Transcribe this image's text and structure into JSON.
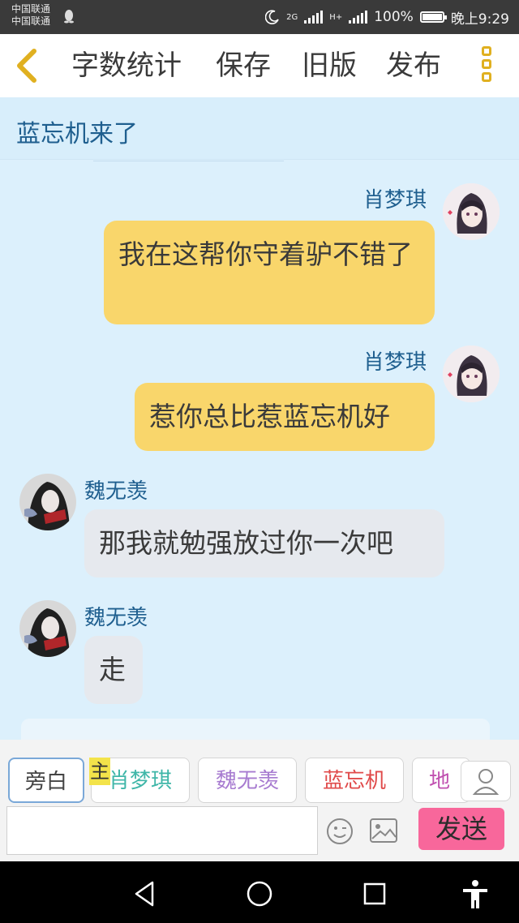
{
  "status_bar": {
    "carrier_1": "中国联通",
    "carrier_2": "中国联通",
    "net_1": "2G",
    "net_2": "H+",
    "battery": "100%",
    "time": "晚上9:29"
  },
  "toolbar": {
    "back_icon": "chevron-left-icon",
    "word_count": "字数统计",
    "save": "保存",
    "old_version": "旧版",
    "publish": "发布",
    "more_icon": "more-vertical-icon",
    "accent_color": "#e0b020"
  },
  "title": "蓝忘机来了",
  "messages": [
    {
      "sender": "肖梦琪",
      "side": "right",
      "text": "我在这帮你守着驴不错了"
    },
    {
      "sender": "肖梦琪",
      "side": "right",
      "text": "惹你总比惹蓝忘机好"
    },
    {
      "sender": "魏无羡",
      "side": "left",
      "text": "那我就勉强放过你一次吧"
    },
    {
      "sender": "魏无羡",
      "side": "left",
      "text": "走"
    }
  ],
  "roles": [
    {
      "label": "旁白",
      "color": "#444444"
    },
    {
      "label": "肖梦琪",
      "color": "#3fb6a8",
      "tag": "主"
    },
    {
      "label": "魏无羡",
      "color": "#a77bd0"
    },
    {
      "label": "蓝忘机",
      "color": "#e04a4a"
    },
    {
      "label": "地府",
      "color": "#c050b0"
    }
  ],
  "input": {
    "value": "",
    "send_label": "发送",
    "send_color": "#f8679b"
  }
}
